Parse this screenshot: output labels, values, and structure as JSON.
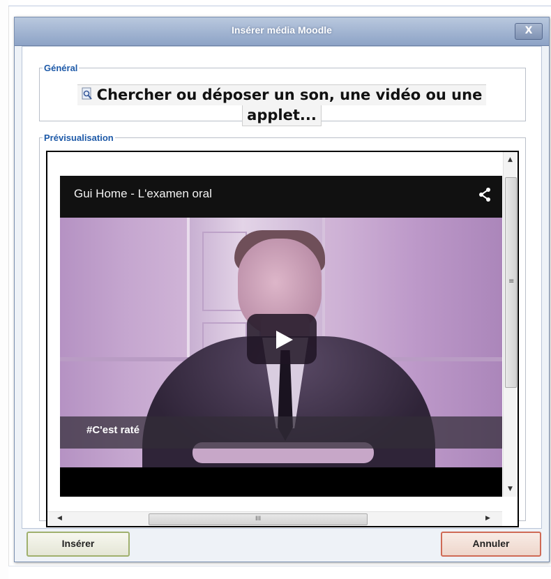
{
  "dialog": {
    "title": "Insérer média Moodle",
    "close_label": "X"
  },
  "general": {
    "legend": "Général",
    "search_line1": "Chercher ou déposer un son, une vidéo ou une",
    "search_line2": "applet..."
  },
  "preview": {
    "legend": "Prévisualisation",
    "video_title": "Gui Home - L'examen oral",
    "caption": "#C'est raté",
    "scroll_grip": "III",
    "vscroll_grip": "≡"
  },
  "buttons": {
    "insert": "Insérer",
    "cancel": "Annuler"
  },
  "icons": [
    "search-icon",
    "share-icon",
    "play-icon",
    "close-icon"
  ],
  "colors": {
    "legend_text": "#1e5aa8",
    "title_bar": "#8da3c6",
    "insert_border": "#9fb06d",
    "cancel_border": "#cf6a55"
  }
}
